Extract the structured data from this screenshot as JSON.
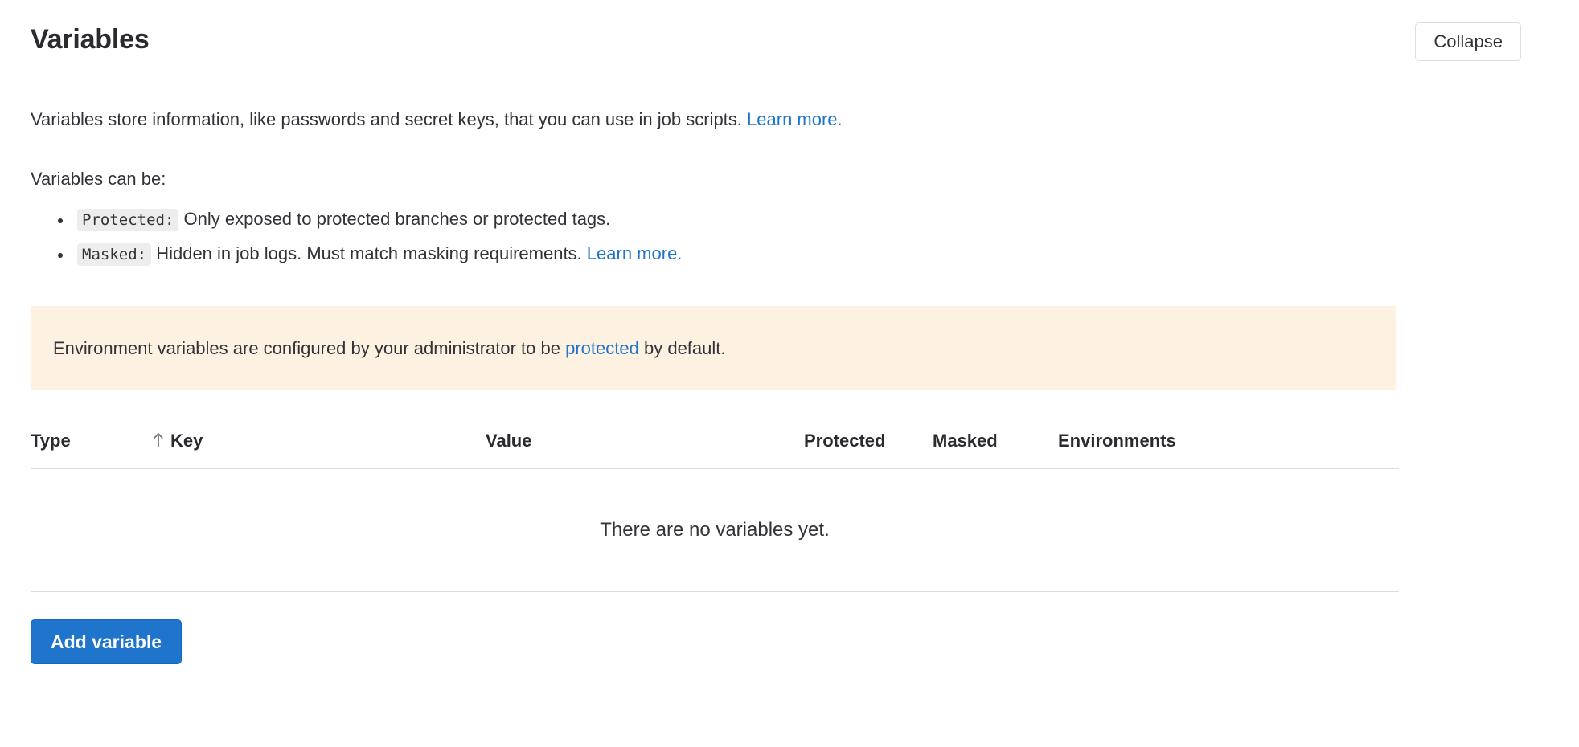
{
  "header": {
    "title": "Variables",
    "collapse_label": "Collapse"
  },
  "intro": {
    "line1_text": "Variables store information, like passwords and secret keys, that you can use in job scripts.",
    "line1_link": "Learn more.",
    "line2_text": "Variables can be:"
  },
  "bullets": [
    {
      "code": "Protected:",
      "text": "Only exposed to protected branches or protected tags.",
      "link": ""
    },
    {
      "code": "Masked:",
      "text": "Hidden in job logs. Must match masking requirements.",
      "link": "Learn more."
    }
  ],
  "alert": {
    "text_before": "Environment variables are configured by your administrator to be",
    "link": "protected",
    "text_after": "by default.",
    "background_color": "#fdf1e1"
  },
  "table": {
    "columns": [
      {
        "label": "Type",
        "sorted": false
      },
      {
        "label": "Key",
        "sorted": true,
        "sort_direction": "asc",
        "sort_icon": "arrow-up-icon"
      },
      {
        "label": "Value",
        "sorted": false
      },
      {
        "label": "Protected",
        "sorted": false
      },
      {
        "label": "Masked",
        "sorted": false
      },
      {
        "label": "Environments",
        "sorted": false
      }
    ],
    "rows": [],
    "empty_message": "There are no variables yet."
  },
  "footer": {
    "add_variable_label": "Add variable",
    "accent_color": "#1f75cb"
  },
  "colors": {
    "link": "#1f75cb",
    "text": "#333238",
    "border": "#dcdcde",
    "code_background": "#ededed"
  }
}
